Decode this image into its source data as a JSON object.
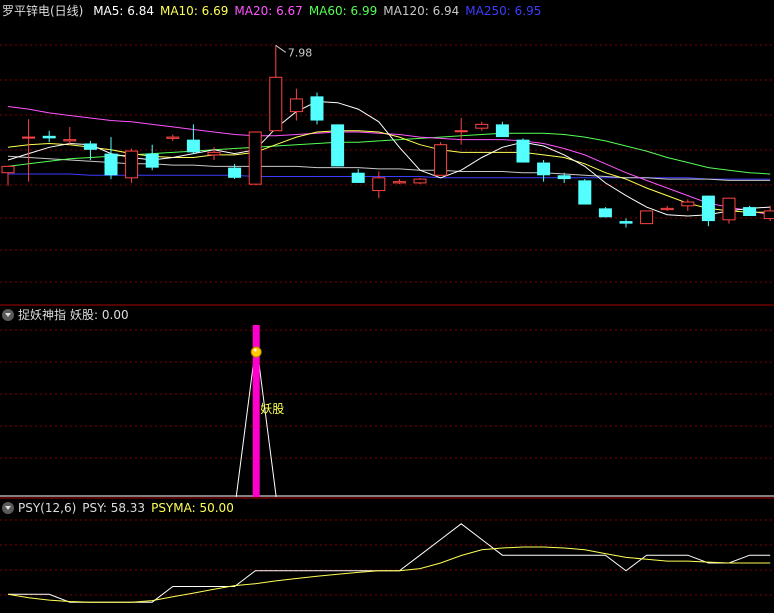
{
  "colors": {
    "up": "#ff4444",
    "down": "#54ffff",
    "ma5": "#ffffff",
    "ma10": "#ffff54",
    "ma20": "#ff54ff",
    "ma60": "#54ff54",
    "ma120": "#c8c8c8",
    "ma250": "#3c3cff",
    "grid": "#800000",
    "separator": "#aa0000",
    "magenta_bar": "#ff00cc"
  },
  "main_panel": {
    "title": "罗平锌电(日线)",
    "legend": [
      {
        "key": "ma5",
        "label": "MA5: 6.84"
      },
      {
        "key": "ma10",
        "label": "MA10: 6.69"
      },
      {
        "key": "ma20",
        "label": "MA20: 6.67"
      },
      {
        "key": "ma60",
        "label": "MA60: 6.99"
      },
      {
        "key": "ma120",
        "label": "MA120: 6.94"
      },
      {
        "key": "ma250",
        "label": "MA250: 6.95"
      }
    ],
    "high_annotation": "7.98"
  },
  "indicator_panel": {
    "title": "捉妖神指",
    "value_label": "妖股: 0.00",
    "signal_label": "妖股"
  },
  "psy_panel": {
    "title": "PSY(12,6)",
    "psy_label": "PSY: 58.33",
    "psyma_label": "PSYMA: 50.00"
  },
  "chart_data": {
    "type": "candlestick",
    "ylim": [
      6.0,
      8.2
    ],
    "candles": [
      {
        "o": 7.0,
        "h": 7.05,
        "l": 6.9,
        "c": 7.05
      },
      {
        "o": 7.28,
        "h": 7.42,
        "l": 6.93,
        "c": 7.28
      },
      {
        "o": 7.29,
        "h": 7.33,
        "l": 7.24,
        "c": 7.27
      },
      {
        "o": 7.25,
        "h": 7.36,
        "l": 7.22,
        "c": 7.26
      },
      {
        "o": 7.23,
        "h": 7.25,
        "l": 7.1,
        "c": 7.18
      },
      {
        "o": 7.15,
        "h": 7.28,
        "l": 6.95,
        "c": 6.98
      },
      {
        "o": 6.96,
        "h": 7.19,
        "l": 6.92,
        "c": 7.17
      },
      {
        "o": 7.15,
        "h": 7.22,
        "l": 7.02,
        "c": 7.04
      },
      {
        "o": 7.27,
        "h": 7.3,
        "l": 7.25,
        "c": 7.28
      },
      {
        "o": 7.26,
        "h": 7.38,
        "l": 7.15,
        "c": 7.16
      },
      {
        "o": 7.14,
        "h": 7.2,
        "l": 7.1,
        "c": 7.16
      },
      {
        "o": 7.04,
        "h": 7.07,
        "l": 6.95,
        "c": 6.96
      },
      {
        "o": 6.91,
        "h": 7.32,
        "l": 6.91,
        "c": 7.32
      },
      {
        "o": 7.33,
        "h": 8.0,
        "l": 7.33,
        "c": 7.75
      },
      {
        "o": 7.48,
        "h": 7.66,
        "l": 7.41,
        "c": 7.58
      },
      {
        "o": 7.6,
        "h": 7.63,
        "l": 7.38,
        "c": 7.41
      },
      {
        "o": 7.38,
        "h": 7.38,
        "l": 7.05,
        "c": 7.05
      },
      {
        "o": 7.0,
        "h": 7.03,
        "l": 6.92,
        "c": 6.92
      },
      {
        "o": 6.86,
        "h": 7.01,
        "l": 6.8,
        "c": 6.96
      },
      {
        "o": 6.92,
        "h": 6.95,
        "l": 6.91,
        "c": 6.93
      },
      {
        "o": 6.92,
        "h": 6.96,
        "l": 6.91,
        "c": 6.95
      },
      {
        "o": 6.98,
        "h": 7.24,
        "l": 6.98,
        "c": 7.22
      },
      {
        "o": 7.33,
        "h": 7.43,
        "l": 7.22,
        "c": 7.33
      },
      {
        "o": 7.35,
        "h": 7.4,
        "l": 7.33,
        "c": 7.38
      },
      {
        "o": 7.38,
        "h": 7.4,
        "l": 7.28,
        "c": 7.28
      },
      {
        "o": 7.26,
        "h": 7.27,
        "l": 7.08,
        "c": 7.08
      },
      {
        "o": 7.08,
        "h": 7.1,
        "l": 6.93,
        "c": 6.98
      },
      {
        "o": 6.98,
        "h": 7.0,
        "l": 6.92,
        "c": 6.95
      },
      {
        "o": 6.94,
        "h": 6.95,
        "l": 6.75,
        "c": 6.75
      },
      {
        "o": 6.72,
        "h": 6.73,
        "l": 6.65,
        "c": 6.65
      },
      {
        "o": 6.62,
        "h": 6.64,
        "l": 6.57,
        "c": 6.6
      },
      {
        "o": 6.6,
        "h": 6.7,
        "l": 6.6,
        "c": 6.7
      },
      {
        "o": 6.71,
        "h": 6.74,
        "l": 6.7,
        "c": 6.72
      },
      {
        "o": 6.74,
        "h": 6.79,
        "l": 6.7,
        "c": 6.77
      },
      {
        "o": 6.82,
        "h": 6.82,
        "l": 6.58,
        "c": 6.62
      },
      {
        "o": 6.63,
        "h": 6.8,
        "l": 6.6,
        "c": 6.8
      },
      {
        "o": 6.73,
        "h": 6.74,
        "l": 6.66,
        "c": 6.66
      },
      {
        "o": 6.64,
        "h": 6.74,
        "l": 6.62,
        "c": 6.7
      }
    ],
    "ma5": [
      7.1,
      7.15,
      7.2,
      7.23,
      7.22,
      7.15,
      7.12,
      7.1,
      7.12,
      7.15,
      7.18,
      7.15,
      7.18,
      7.35,
      7.48,
      7.56,
      7.55,
      7.5,
      7.4,
      7.2,
      7.02,
      6.96,
      7.02,
      7.12,
      7.2,
      7.24,
      7.21,
      7.14,
      7.05,
      6.92,
      6.82,
      6.73,
      6.67,
      6.66,
      6.67,
      6.7,
      6.72,
      6.73
    ],
    "ma10": [
      7.2,
      7.22,
      7.23,
      7.22,
      7.2,
      7.18,
      7.15,
      7.13,
      7.12,
      7.12,
      7.14,
      7.14,
      7.16,
      7.22,
      7.28,
      7.32,
      7.33,
      7.33,
      7.32,
      7.28,
      7.22,
      7.18,
      7.16,
      7.16,
      7.16,
      7.16,
      7.14,
      7.12,
      7.07,
      7.0,
      6.95,
      6.88,
      6.82,
      6.76,
      6.72,
      6.7,
      6.69,
      6.69
    ],
    "ma20": [
      7.52,
      7.5,
      7.47,
      7.45,
      7.43,
      7.41,
      7.4,
      7.38,
      7.36,
      7.34,
      7.32,
      7.3,
      7.29,
      7.29,
      7.3,
      7.31,
      7.32,
      7.32,
      7.31,
      7.3,
      7.28,
      7.27,
      7.26,
      7.26,
      7.26,
      7.25,
      7.23,
      7.19,
      7.14,
      7.07,
      7.0,
      6.94,
      6.88,
      6.82,
      6.76,
      6.73,
      6.7,
      6.67
    ],
    "ma60": [
      7.05,
      7.07,
      7.09,
      7.11,
      7.12,
      7.13,
      7.14,
      7.15,
      7.16,
      7.17,
      7.18,
      7.19,
      7.2,
      7.21,
      7.22,
      7.23,
      7.24,
      7.24,
      7.25,
      7.26,
      7.27,
      7.28,
      7.29,
      7.3,
      7.31,
      7.31,
      7.31,
      7.3,
      7.28,
      7.25,
      7.21,
      7.17,
      7.12,
      7.08,
      7.04,
      7.02,
      7.0,
      6.99
    ],
    "ma120": [
      7.13,
      7.12,
      7.11,
      7.1,
      7.09,
      7.08,
      7.07,
      7.07,
      7.06,
      7.06,
      7.05,
      7.05,
      7.05,
      7.05,
      7.05,
      7.04,
      7.04,
      7.04,
      7.03,
      7.03,
      7.02,
      7.02,
      7.01,
      7.01,
      7.01,
      7.0,
      7.0,
      6.99,
      6.98,
      6.97,
      6.96,
      6.96,
      6.95,
      6.95,
      6.95,
      6.94,
      6.94,
      6.94
    ],
    "ma250": [
      6.99,
      6.99,
      6.99,
      6.99,
      6.98,
      6.98,
      6.98,
      6.98,
      6.98,
      6.98,
      6.98,
      6.98,
      6.97,
      6.97,
      6.97,
      6.97,
      6.97,
      6.97,
      6.97,
      6.97,
      6.97,
      6.96,
      6.96,
      6.96,
      6.96,
      6.96,
      6.96,
      6.96,
      6.96,
      6.96,
      6.96,
      6.96,
      6.96,
      6.96,
      6.95,
      6.95,
      6.95,
      6.95
    ],
    "yao_signal": [
      0,
      0,
      0,
      0,
      0,
      0,
      0,
      0,
      0,
      0,
      0,
      0,
      100,
      0,
      0,
      0,
      0,
      0,
      0,
      0,
      0,
      0,
      0,
      0,
      0,
      0,
      0,
      0,
      0,
      0,
      0,
      0,
      0,
      0,
      0,
      0,
      0,
      0
    ],
    "psy": [
      16.67,
      16.67,
      16.67,
      8.33,
      8.33,
      8.33,
      8.33,
      8.33,
      25.0,
      25.0,
      25.0,
      25.0,
      41.67,
      41.67,
      41.67,
      41.67,
      41.67,
      41.67,
      41.67,
      41.67,
      58.33,
      75.0,
      91.67,
      75.0,
      58.33,
      58.33,
      58.33,
      58.33,
      58.33,
      58.33,
      41.67,
      58.33,
      58.33,
      58.33,
      50.0,
      50.0,
      58.33,
      58.33
    ],
    "psyma": [
      16.67,
      13.0,
      10.5,
      9.0,
      8.33,
      8.33,
      8.33,
      10.0,
      14.0,
      18.0,
      22.0,
      26.0,
      28.0,
      31.0,
      33.5,
      36.0,
      38.0,
      40.0,
      41.67,
      41.67,
      44.0,
      50.0,
      58.0,
      64.0,
      66.0,
      67.0,
      67.0,
      66.0,
      64.0,
      60.0,
      56.0,
      54.0,
      52.0,
      52.0,
      51.0,
      50.0,
      50.0,
      50.0
    ],
    "psy_ylim": [
      0,
      100
    ]
  }
}
